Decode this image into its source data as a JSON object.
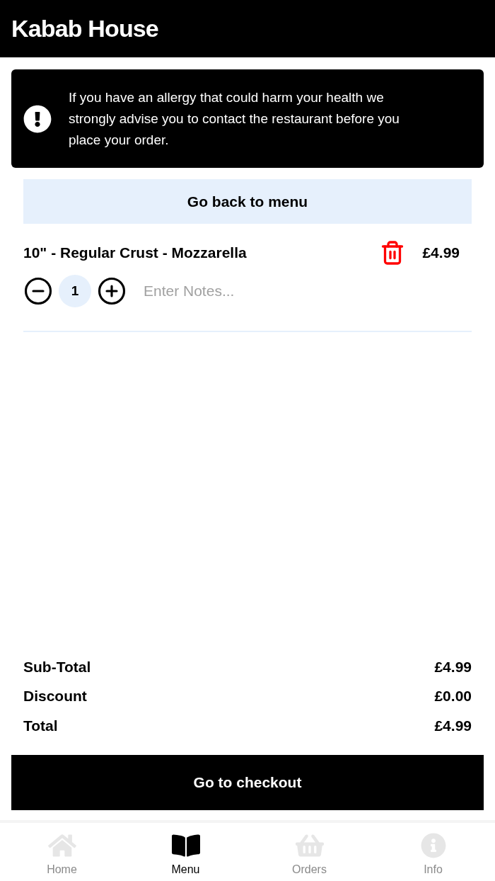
{
  "header": {
    "title": "Kabab House"
  },
  "alert": {
    "text": "If you have an allergy that could harm your health we strongly advise you to contact the restaurant before you place your order."
  },
  "back_button": "Go back to menu",
  "cart_items": [
    {
      "name": "10\" - Regular Crust - Mozzarella",
      "price": "£4.99",
      "quantity": "1",
      "notes_placeholder": "Enter Notes..."
    }
  ],
  "totals": [
    {
      "label": "Sub-Total",
      "value": "£4.99"
    },
    {
      "label": "Discount",
      "value": "£0.00"
    },
    {
      "label": "Total",
      "value": "£4.99"
    }
  ],
  "checkout_button": "Go to checkout",
  "nav": [
    {
      "kind": "home",
      "label": "Home",
      "selected": false
    },
    {
      "kind": "menu",
      "label": "Menu",
      "selected": true
    },
    {
      "kind": "orders",
      "label": "Orders",
      "selected": false
    },
    {
      "kind": "info",
      "label": "Info",
      "selected": false
    }
  ]
}
